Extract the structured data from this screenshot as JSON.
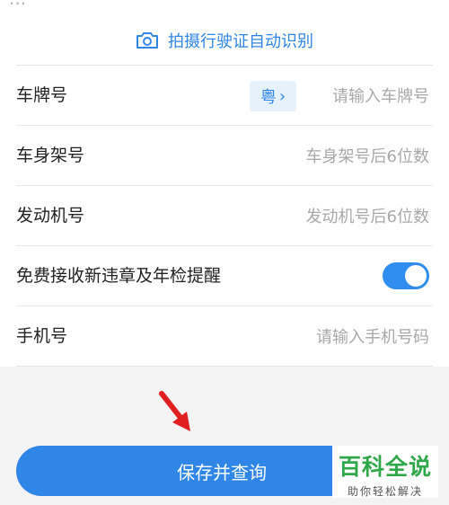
{
  "header_fragment": "...",
  "ocr": {
    "label": "拍摄行驶证自动识别",
    "icon": "camera-icon"
  },
  "form": {
    "plate": {
      "label": "车牌号",
      "province": "粤",
      "placeholder": "请输入车牌号"
    },
    "vin": {
      "label": "车身架号",
      "placeholder": "车身架号后6位数"
    },
    "engine": {
      "label": "发动机号",
      "placeholder": "发动机号后6位数"
    },
    "reminder": {
      "label": "免费接收新违章及年检提醒",
      "enabled": true
    },
    "phone": {
      "label": "手机号",
      "placeholder": "请输入手机号码"
    }
  },
  "actions": {
    "save_label": "保存并查询"
  },
  "watermark": {
    "title": "百科全说",
    "subtitle": "助你轻松解决"
  },
  "colors": {
    "accent": "#2f86e6",
    "toggle": "#2f8ef0",
    "arrow": "#e02020",
    "watermark": "#2fa84a"
  }
}
